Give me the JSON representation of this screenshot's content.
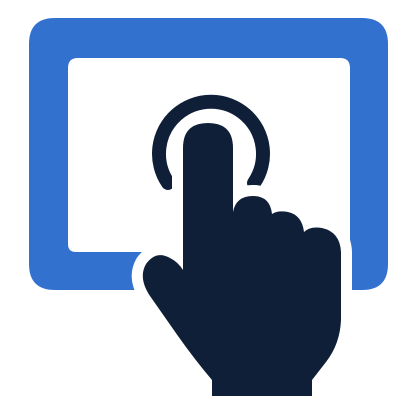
{
  "icon": {
    "name": "touchscreen-tap-icon",
    "parts": [
      "screen-frame",
      "tap-ripple",
      "pointing-hand"
    ]
  },
  "colors": {
    "screen_frame": "#3371CF",
    "hand": "#0F1F38",
    "background": "#FFFFFF"
  }
}
